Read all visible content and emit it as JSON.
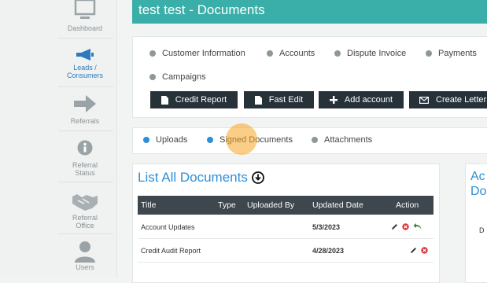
{
  "sidebar": {
    "items": [
      {
        "label": "Dashboard"
      },
      {
        "label": "Leads / Consumers"
      },
      {
        "label": "Referrals"
      },
      {
        "label": "Referral Status"
      },
      {
        "label": "Referral Office"
      },
      {
        "label": "Users"
      }
    ]
  },
  "header": {
    "title": "test test - Documents"
  },
  "links": {
    "items": [
      "Customer Information",
      "Accounts",
      "Dispute Invoice",
      "Payments",
      "Campaigns"
    ]
  },
  "actions": {
    "credit_report": "Credit Report",
    "fast_edit": "Fast Edit",
    "add_account": "Add account",
    "create_letter": "Create Letter"
  },
  "tabs": {
    "uploads": "Uploads",
    "signed_documents": "Signed Documents",
    "attachments": "Attachments"
  },
  "documents": {
    "heading": "List All Documents",
    "columns": [
      "Title",
      "Type",
      "Uploaded By",
      "Updated Date",
      "Action"
    ],
    "rows": [
      {
        "title": "Account Updates",
        "type": "",
        "uploaded_by": "",
        "updated_date": "5/3/2023"
      },
      {
        "title": "Credit Audit Report",
        "type": "",
        "uploaded_by": "",
        "updated_date": "4/28/2023"
      }
    ]
  },
  "side_panel": {
    "line1": "Ac",
    "line2": "Do",
    "line3": "D"
  },
  "colors": {
    "accent": "#3aaea8",
    "link_blue": "#2d8fd6",
    "dark": "#263238",
    "highlight": "#f5a623"
  }
}
